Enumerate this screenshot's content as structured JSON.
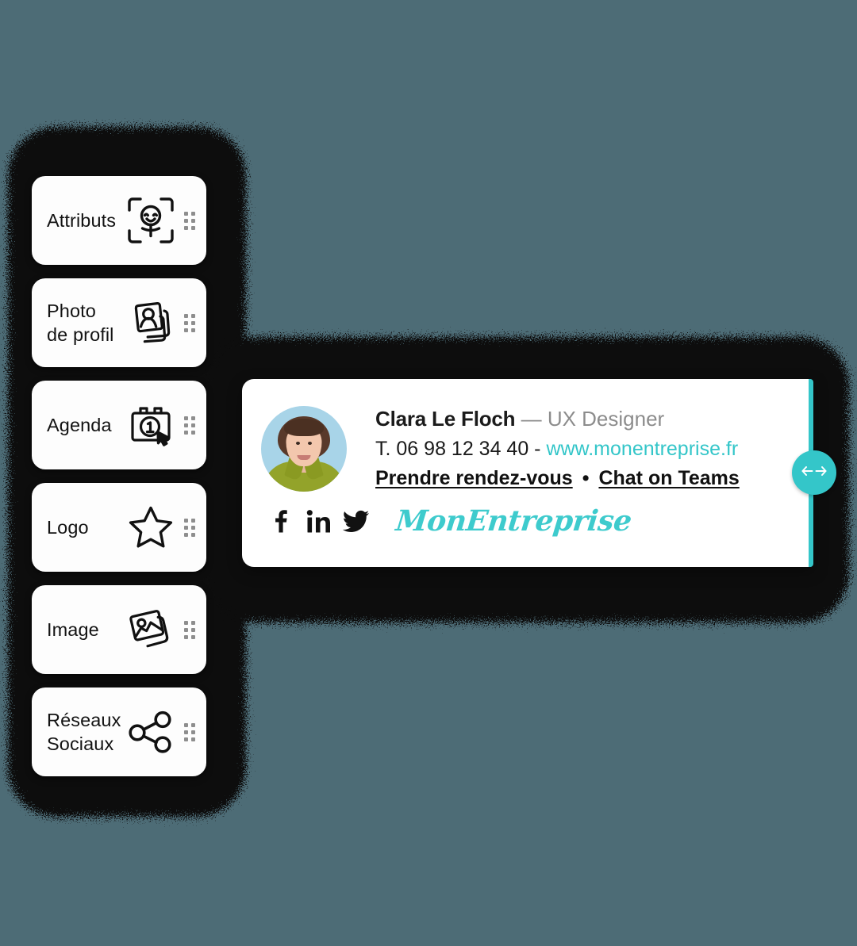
{
  "theme": {
    "background_color": "#4d6c76",
    "backdrop_color": "#0a0a0a",
    "accent_color": "#34c6c9",
    "card_color": "#ffffff"
  },
  "sidebar": {
    "items": [
      {
        "label": "Attributs",
        "icon": "person-frame-icon",
        "handle": "drag-handle-icon"
      },
      {
        "label": "Photo\nde profil",
        "icon": "profile-photo-icon",
        "handle": "drag-handle-icon"
      },
      {
        "label": "Agenda",
        "icon": "calendar-click-icon",
        "handle": "drag-handle-icon"
      },
      {
        "label": "Logo",
        "icon": "star-icon",
        "handle": "drag-handle-icon"
      },
      {
        "label": "Image",
        "icon": "images-icon",
        "handle": "drag-handle-icon"
      },
      {
        "label": "Réseaux\nSociaux",
        "icon": "share-network-icon",
        "handle": "drag-handle-icon"
      }
    ]
  },
  "signature": {
    "avatar_alt": "avatar-photo",
    "name": "Clara Le Floch",
    "dash": " — ",
    "role": "UX Designer",
    "phone_prefix": "T. ",
    "phone": "06 98  12 34 40",
    "phone_web_sep": " - ",
    "website": "www.monentreprise.fr",
    "link_appointment": "Prendre rendez-vous",
    "link_separator": "•",
    "link_teams": "Chat on Teams",
    "social": [
      {
        "name": "facebook-icon",
        "label": "f"
      },
      {
        "name": "linkedin-icon",
        "label": "in"
      },
      {
        "name": "twitter-icon",
        "label": "twitter"
      }
    ],
    "company": "MonEntreprise"
  },
  "resize_handle": {
    "icon": "left-right-arrows-icon",
    "label": "↔"
  }
}
